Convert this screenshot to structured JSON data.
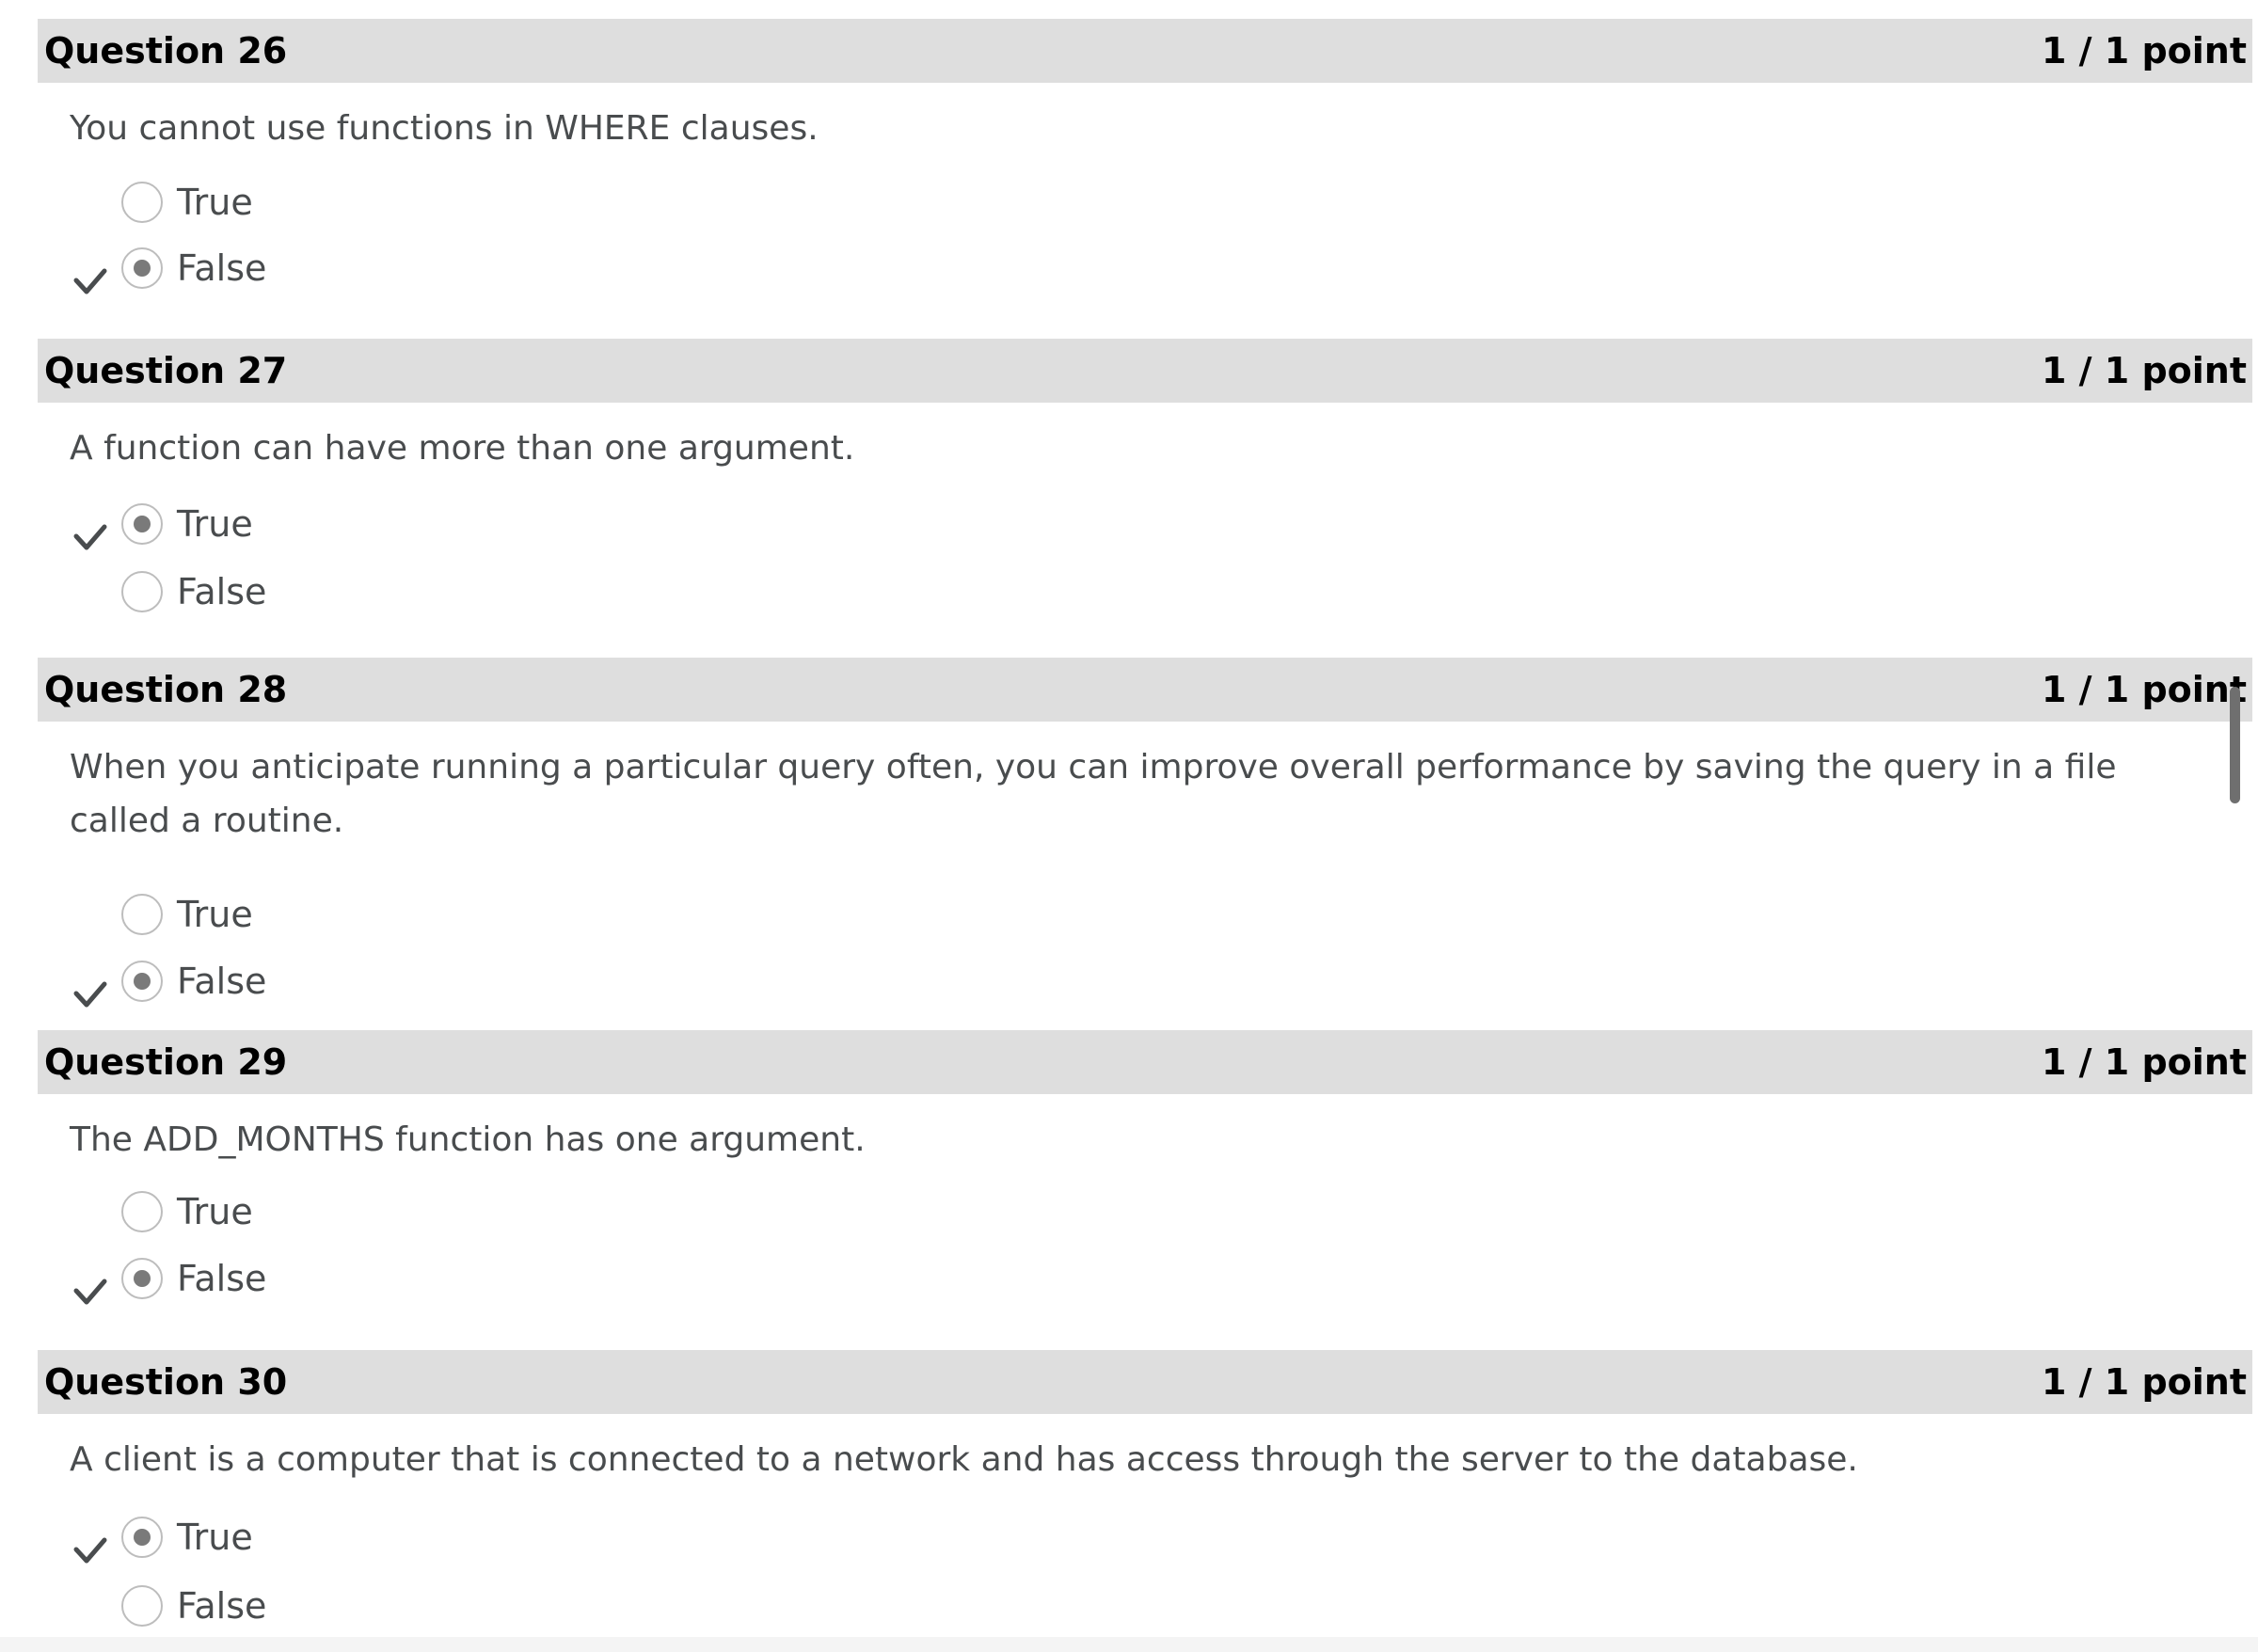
{
  "questions": [
    {
      "title": "Question 26",
      "score": "1 / 1 point",
      "text": "You cannot use functions in WHERE clauses.",
      "options": [
        {
          "label": "True",
          "selected": false,
          "correct": false
        },
        {
          "label": "False",
          "selected": true,
          "correct": true
        }
      ]
    },
    {
      "title": "Question 27",
      "score": "1 / 1 point",
      "text": "A function can have more than one argument.",
      "options": [
        {
          "label": "True",
          "selected": true,
          "correct": true
        },
        {
          "label": "False",
          "selected": false,
          "correct": false
        }
      ]
    },
    {
      "title": "Question 28",
      "score": "1 / 1 point",
      "text": "When you anticipate running a particular query often, you can improve overall performance by saving the query in a file called a routine.",
      "options": [
        {
          "label": "True",
          "selected": false,
          "correct": false
        },
        {
          "label": "False",
          "selected": true,
          "correct": true
        }
      ]
    },
    {
      "title": "Question 29",
      "score": "1 / 1 point",
      "text": "The ADD_MONTHS function has one argument.",
      "options": [
        {
          "label": "True",
          "selected": false,
          "correct": false
        },
        {
          "label": "False",
          "selected": true,
          "correct": true
        }
      ]
    },
    {
      "title": "Question 30",
      "score": "1 / 1 point",
      "text": "A client is a computer that is connected to a network and has access through the server to the database.",
      "options": [
        {
          "label": "True",
          "selected": true,
          "correct": true
        },
        {
          "label": "False",
          "selected": false,
          "correct": false
        }
      ]
    }
  ],
  "icons": {
    "correct": "checkmark-icon"
  },
  "colors": {
    "header_bg": "#dedede",
    "text": "#494c4e",
    "radio_dot": "#7a7a7a",
    "checkmark": "#494c4e"
  }
}
